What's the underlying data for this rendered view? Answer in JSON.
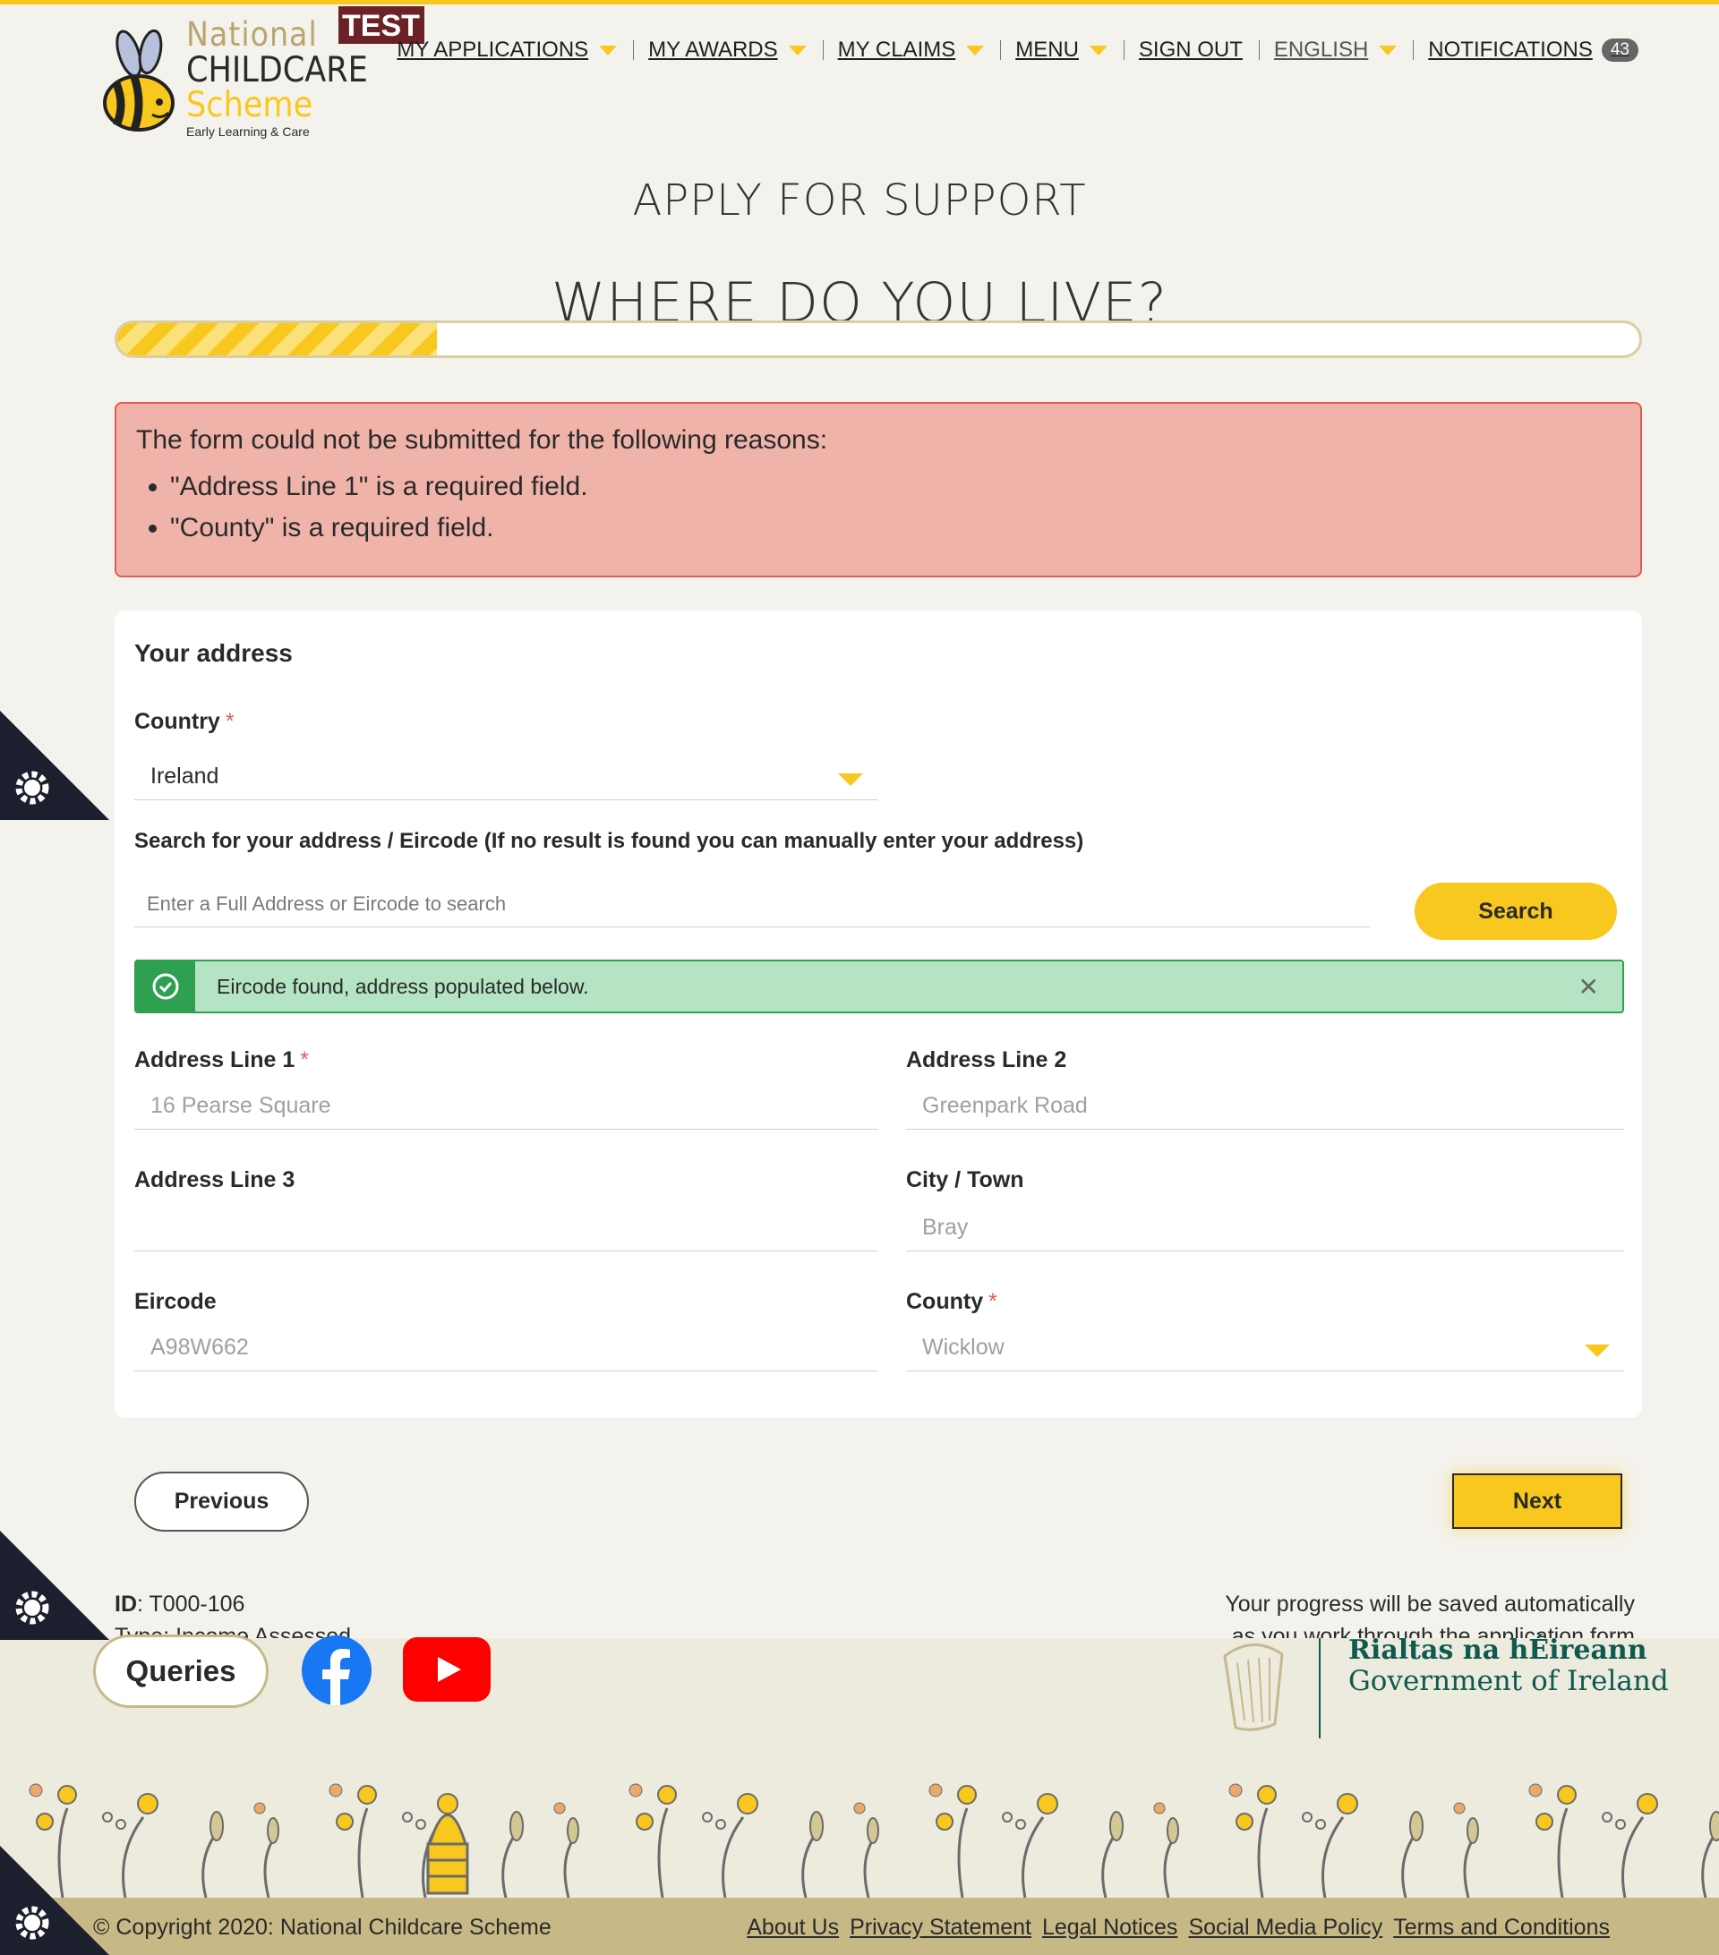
{
  "brand": {
    "line1": "National",
    "line2": "CHILDCARE",
    "line3": "Scheme",
    "line4": "Early Learning & Care",
    "env_badge": "TEST",
    "accent_color": "#f9c81e"
  },
  "nav": {
    "items": [
      {
        "label": "MY APPLICATIONS",
        "dropdown": true
      },
      {
        "label": "MY AWARDS",
        "dropdown": true
      },
      {
        "label": "MY CLAIMS",
        "dropdown": true
      },
      {
        "label": "MENU",
        "dropdown": true
      },
      {
        "label": "SIGN OUT",
        "dropdown": false
      },
      {
        "label": "ENGLISH",
        "dropdown": true
      },
      {
        "label": "NOTIFICATIONS",
        "dropdown": false
      }
    ],
    "notifications_count": "43"
  },
  "page": {
    "heading": "APPLY FOR SUPPORT",
    "subheading": "WHERE DO YOU LIVE?",
    "progress_fraction": 0.21
  },
  "errors": {
    "title": "The form could not be submitted for the following reasons:",
    "items": [
      "\"Address Line 1\" is a required field.",
      "\"County\" is a required field."
    ],
    "color": "#e05b52"
  },
  "form": {
    "section_title": "Your address",
    "country": {
      "label": "Country",
      "value": "Ireland"
    },
    "search": {
      "label": "Search for your address / Eircode (If no result is found you can manually enter your address)",
      "placeholder": "Enter a Full Address or Eircode to search",
      "button": "Search"
    },
    "success_message": "Eircode found, address populated below.",
    "address_line_1": {
      "label": "Address Line 1",
      "value": "16 Pearse Square"
    },
    "address_line_2": {
      "label": "Address Line 2",
      "value": "Greenpark Road"
    },
    "address_line_3": {
      "label": "Address Line 3",
      "value": ""
    },
    "city_town": {
      "label": "City / Town",
      "value": "Bray"
    },
    "eircode": {
      "label": "Eircode",
      "value": "A98W662"
    },
    "county": {
      "label": "County",
      "value": "Wicklow"
    },
    "required_marker": "*"
  },
  "actions": {
    "previous": "Previous",
    "next": "Next"
  },
  "meta": {
    "id_label": "ID",
    "id_value": ": T000-106",
    "type_text": "Type: Income Assessed",
    "autosave": "Your progress will be saved automatically as you work through the application form"
  },
  "footer": {
    "queries": "Queries",
    "gov_irish": "Rialtas na hÉireann",
    "gov_english": "Government of Ireland",
    "copyright": "© Copyright 2020: National Childcare Scheme",
    "links": [
      "About Us",
      "Privacy Statement",
      "Legal Notices",
      "Social Media Policy",
      "Terms and Conditions"
    ]
  }
}
